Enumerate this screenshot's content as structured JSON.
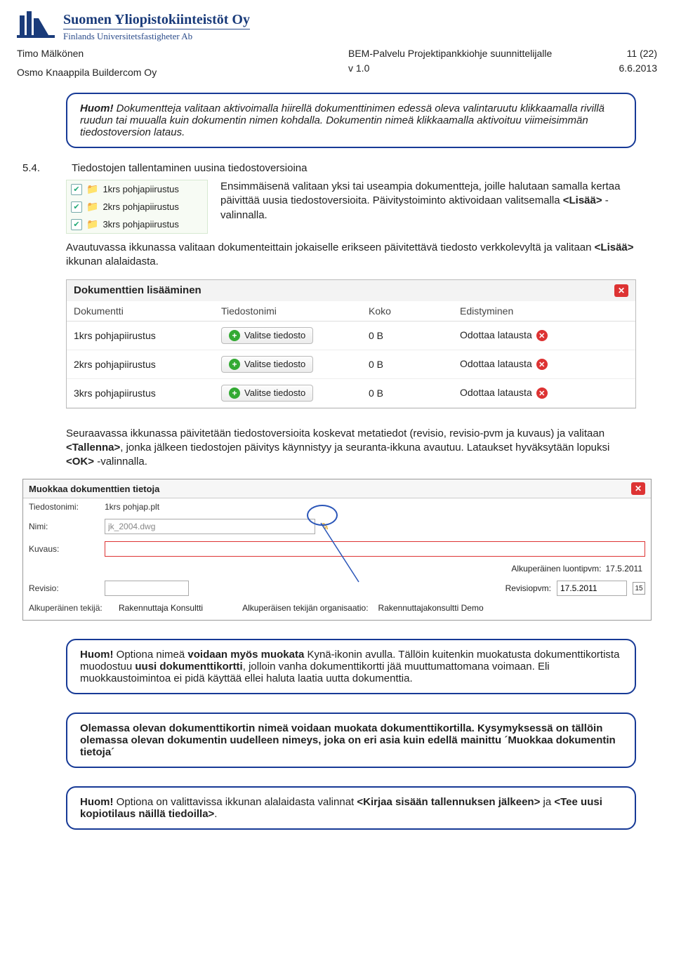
{
  "org": {
    "name_fi": "Suomen Yliopistokiinteistöt Oy",
    "name_sv": "Finlands Universitetsfastigheter Ab"
  },
  "header": {
    "author1": "Timo Mälkönen",
    "author2": "Osmo Knaappila Buildercom Oy",
    "doc_title": "BEM-Palvelu Projektipankkiohje suunnittelijalle",
    "version": "v 1.0",
    "page": "11 (22)",
    "date": "6.6.2013"
  },
  "note1_prefix": "Huom!",
  "note1_body": " Dokumentteja valitaan aktivoimalla hiirellä dokumenttinimen edessä oleva valintaruutu klikkaamalla rivillä ruudun tai muualla kuin dokumentin nimen kohdalla. Dokumentin nimeä klikkaamalla aktivoituu viimeisimmän tiedostoversion lataus.",
  "sec_num": "5.4.",
  "sec_title": "Tiedostojen tallentaminen uusina tiedostoversioina",
  "checklist": [
    "1krs pohjapiirustus",
    "2krs pohjapiirustus",
    "3krs pohjapiirustus"
  ],
  "p1": "Ensimmäisenä valitaan yksi tai useampia dokumentteja, joille halutaan samalla kertaa päivittää uusia tiedostoversioita. Päivitystoiminto aktivoidaan valitsemalla ",
  "p1b": "<Lisää>",
  "p1c": " -valinnalla.",
  "p2a": "Avautuvassa ikkunassa valitaan dokumenteittain jokaiselle erikseen päivitettävä tiedosto verkkolevyltä ja valitaan ",
  "p2b": "<Lisää>",
  "p2c": " ikkunan alalaidasta.",
  "dialog1": {
    "title": "Dokumenttien lisääminen",
    "cols": [
      "Dokumentti",
      "Tiedostonimi",
      "Koko",
      "Edistyminen"
    ],
    "btn": "Valitse tiedosto",
    "rows": [
      {
        "name": "1krs pohjapiirustus",
        "size": "0 B",
        "status": "Odottaa latausta"
      },
      {
        "name": "2krs pohjapiirustus",
        "size": "0 B",
        "status": "Odottaa latausta"
      },
      {
        "name": "3krs pohjapiirustus",
        "size": "0 B",
        "status": "Odottaa latausta"
      }
    ]
  },
  "p3a": "Seuraavassa ikkunassa päivitetään tiedostoversioita koskevat metatiedot (revisio, revisio-pvm ja kuvaus) ja valitaan ",
  "p3b": "<Tallenna>",
  "p3c": ", jonka jälkeen tiedostojen päivitys käynnistyy ja seuranta-ikkuna avautuu. Lataukset hyväksytään lopuksi ",
  "p3d": "<OK>",
  "p3e": " -valinnalla.",
  "dialog2": {
    "title": "Muokkaa dokumenttien tietoja",
    "labels": {
      "tiedostonimi": "Tiedostonimi:",
      "nimi": "Nimi:",
      "kuvaus": "Kuvaus:",
      "revisio": "Revisio:",
      "alkup_tekija": "Alkuperäinen tekijä:",
      "alkup_org": "Alkuperäisen tekijän organisaatio:",
      "alkup_luonti": "Alkuperäinen luontipvm:",
      "revisiopvm": "Revisiopvm:"
    },
    "values": {
      "tiedostonimi": "1krs pohjap.plt",
      "nimi": "jk_2004.dwg",
      "alkup_tekija": "Rakennuttaja Konsultti",
      "alkup_org": "Rakennuttajakonsultti Demo",
      "alkup_luonti": "17.5.2011",
      "revisiopvm": "17.5.2011"
    }
  },
  "note2_prefix": "Huom!",
  "note2_a": " Optiona nimeä ",
  "note2_b": "voidaan myös muokata",
  "note2_c": " Kynä-ikonin avulla. Tällöin kuitenkin muokatusta dokumenttikortista muodostuu ",
  "note2_d": "uusi dokumenttikortti",
  "note2_e": ", jolloin vanha dokumenttikortti jää muuttumattomana voimaan. Eli muokkaustoimintoa ei pidä käyttää ellei haluta laatia uutta dokumenttia.",
  "note3": "Olemassa olevan dokumenttikortin nimeä voidaan muokata dokumenttikortilla. Kysymyksessä on tällöin olemassa olevan dokumentin uudelleen nimeys, joka on eri asia kuin edellä mainittu ´Muokkaa dokumentin tietoja´",
  "note4_prefix": "Huom!",
  "note4_a": " Optiona on valittavissa ikkunan alalaidasta valinnat ",
  "note4_b": "<Kirjaa sisään tallennuksen jälkeen>",
  "note4_c": " ja ",
  "note4_d": "<Tee uusi kopiotilaus näillä tiedoilla>",
  "note4_e": "."
}
